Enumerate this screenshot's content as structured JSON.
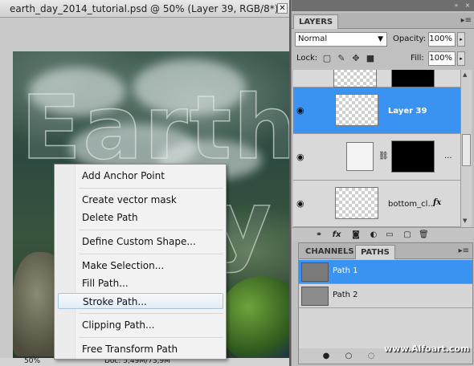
{
  "document": {
    "title": "earth_day_2014_tutorial.psd @ 50% (Layer 39, RGB/8*) *",
    "close_glyph": "✕",
    "zoom": "50%",
    "doc_info": "Doc: 5,49M/73,9M"
  },
  "context_menu": {
    "items": [
      {
        "label": "Add Anchor Point"
      },
      {
        "label": "Create vector mask"
      },
      {
        "label": "Delete Path"
      },
      {
        "label": "Define Custom Shape..."
      },
      {
        "label": "Make Selection..."
      },
      {
        "label": "Fill Path..."
      },
      {
        "label": "Stroke Path..."
      },
      {
        "label": "Clipping Path..."
      },
      {
        "label": "Free Transform Path"
      }
    ],
    "highlighted": "Stroke Path..."
  },
  "layers_panel": {
    "tab": "LAYERS",
    "blend_mode": "Normal",
    "opacity_label": "Opacity:",
    "opacity": "100%",
    "lock_label": "Lock:",
    "fill_label": "Fill:",
    "fill": "100%",
    "layers": [
      {
        "name": "",
        "visible": false
      },
      {
        "name": "Layer 39",
        "visible": true,
        "selected": true
      },
      {
        "name": "...",
        "visible": true
      },
      {
        "name": "bottom_cl...",
        "visible": true,
        "fx": "fx"
      }
    ]
  },
  "paths_panel": {
    "tabs": {
      "channels": "CHANNELS",
      "paths": "PATHS"
    },
    "active_tab": "PATHS",
    "items": [
      {
        "name": "Path 1",
        "selected": true
      },
      {
        "name": "Path 2",
        "selected": false
      }
    ]
  },
  "watermark": "www.Alfoart.com",
  "colors": {
    "selection": "#3a93f0",
    "panel_bg": "#c0c0c0"
  }
}
